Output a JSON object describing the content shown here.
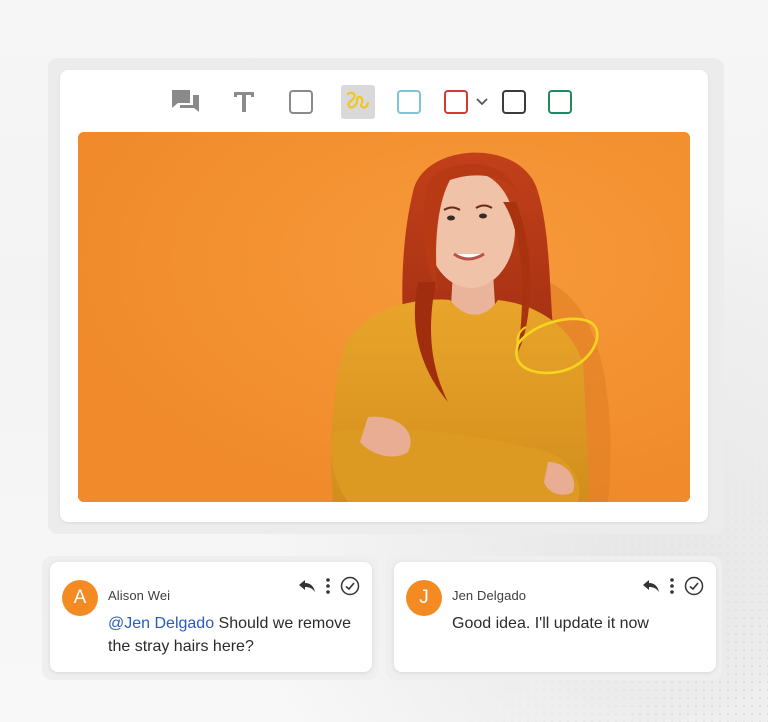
{
  "toolbar": {
    "tools": [
      {
        "name": "comments-tool",
        "icon": "comments-icon"
      },
      {
        "name": "text-tool",
        "icon": "text-icon"
      },
      {
        "name": "rectangle-tool",
        "icon": "square-icon"
      },
      {
        "name": "freehand-tool",
        "icon": "freehand-icon",
        "active": true
      },
      {
        "name": "color-light-blue",
        "icon": "square-icon",
        "color": "#7dc4d6"
      },
      {
        "name": "color-red",
        "icon": "square-icon",
        "color": "#d23a33"
      },
      {
        "name": "color-dropdown",
        "icon": "chevron-down-icon"
      },
      {
        "name": "color-black",
        "icon": "square-icon",
        "color": "#3b3b3b"
      },
      {
        "name": "color-green",
        "icon": "square-icon",
        "color": "#1f8a5c"
      }
    ]
  },
  "colors": {
    "canvas_bg": "#f4902f",
    "annotation": "#f5d51e",
    "avatar": "#f38a22",
    "mention": "#2a5bbf"
  },
  "comments": [
    {
      "initial": "A",
      "author": "Alison Wei",
      "mention": "@Jen Delgado",
      "text": " Should we remove the stray hairs here?"
    },
    {
      "initial": "J",
      "author": "Jen Delgado",
      "mention": "",
      "text": "Good idea. I'll update it now"
    }
  ]
}
